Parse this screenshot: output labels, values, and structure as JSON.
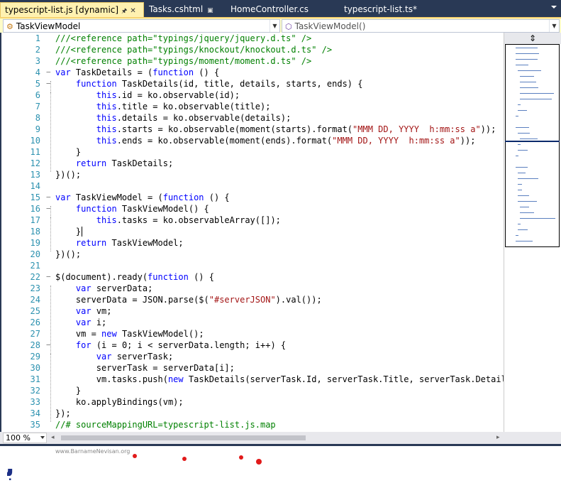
{
  "tabs": [
    {
      "label": "typescript-list.js [dynamic]",
      "active": true
    },
    {
      "label": "Tasks.cshtml",
      "active": false
    },
    {
      "label": "HomeController.cs",
      "active": false
    },
    {
      "label": "typescript-list.ts*",
      "active": false
    }
  ],
  "nav": {
    "type_combo": "TaskViewModel",
    "member_combo": "TaskViewModel()"
  },
  "lines": [
    {
      "n": "1",
      "f": "",
      "html": "<span class='c'>///&lt;reference path=\"typings/jquery/jquery.d.ts\" /&gt;</span>"
    },
    {
      "n": "2",
      "f": "",
      "html": "<span class='c'>///&lt;reference path=\"typings/knockout/knockout.d.ts\" /&gt;</span>"
    },
    {
      "n": "3",
      "f": "",
      "html": "<span class='c'>///&lt;reference path=\"typings/moment/moment.d.ts\" /&gt;</span>"
    },
    {
      "n": "4",
      "f": "−",
      "html": "<span class='k'>var</span> TaskDetails = (<span class='k'>function</span> () {"
    },
    {
      "n": "5",
      "f": "−",
      "html": "    <span class='k'>function</span> TaskDetails(id, title, details, starts, ends) {"
    },
    {
      "n": "6",
      "f": "",
      "html": "        <span class='k'>this</span>.id = ko.observable(id);"
    },
    {
      "n": "7",
      "f": "",
      "html": "        <span class='k'>this</span>.title = ko.observable(title);"
    },
    {
      "n": "8",
      "f": "",
      "html": "        <span class='k'>this</span>.details = ko.observable(details);"
    },
    {
      "n": "9",
      "f": "",
      "html": "        <span class='k'>this</span>.starts = ko.observable(moment(starts).format(<span class='s'>\"MMM DD, YYYY  h:mm:ss a\"</span>));"
    },
    {
      "n": "10",
      "f": "",
      "html": "        <span class='k'>this</span>.ends = ko.observable(moment(ends).format(<span class='s'>\"MMM DD, YYYY  h:mm:ss a\"</span>));"
    },
    {
      "n": "11",
      "f": "",
      "html": "    }"
    },
    {
      "n": "12",
      "f": "",
      "html": "    <span class='k'>return</span> TaskDetails;"
    },
    {
      "n": "13",
      "f": "",
      "html": "})();"
    },
    {
      "n": "14",
      "f": "",
      "html": ""
    },
    {
      "n": "15",
      "f": "−",
      "html": "<span class='k'>var</span> TaskViewModel = (<span class='k'>function</span> () {"
    },
    {
      "n": "16",
      "f": "−",
      "html": "    <span class='k'>function</span> TaskViewModel() {"
    },
    {
      "n": "17",
      "f": "",
      "html": "        <span class='k'>this</span>.tasks = ko.observableArray([]);"
    },
    {
      "n": "18",
      "f": "",
      "html": "    }"
    },
    {
      "n": "19",
      "f": "",
      "html": "    <span class='k'>return</span> TaskViewModel;"
    },
    {
      "n": "20",
      "f": "",
      "html": "})();"
    },
    {
      "n": "21",
      "f": "",
      "html": ""
    },
    {
      "n": "22",
      "f": "−",
      "html": "$(document).ready(<span class='k'>function</span> () {"
    },
    {
      "n": "23",
      "f": "",
      "html": "    <span class='k'>var</span> serverData;"
    },
    {
      "n": "24",
      "f": "",
      "html": "    serverData = JSON.parse($(<span class='s'>\"#serverJSON\"</span>).val());"
    },
    {
      "n": "25",
      "f": "",
      "html": "    <span class='k'>var</span> vm;"
    },
    {
      "n": "26",
      "f": "",
      "html": "    <span class='k'>var</span> i;"
    },
    {
      "n": "27",
      "f": "",
      "html": "    vm = <span class='k'>new</span> TaskViewModel();"
    },
    {
      "n": "28",
      "f": "−",
      "html": "    <span class='k'>for</span> (i = 0; i &lt; serverData.length; i++) {"
    },
    {
      "n": "29",
      "f": "",
      "html": "        <span class='k'>var</span> serverTask;"
    },
    {
      "n": "30",
      "f": "",
      "html": "        serverTask = serverData[i];"
    },
    {
      "n": "31",
      "f": "",
      "html": "        vm.tasks.push(<span class='k'>new</span> TaskDetails(serverTask.Id, serverTask.Title, serverTask.Details,"
    },
    {
      "n": "32",
      "f": "",
      "html": "    }"
    },
    {
      "n": "33",
      "f": "",
      "html": "    ko.applyBindings(vm);"
    },
    {
      "n": "34",
      "f": "",
      "html": "});"
    },
    {
      "n": "35",
      "f": "",
      "html": "<span class='c'>//# sourceMappingURL=typescript-list.js.map</span>"
    }
  ],
  "zoom": "100 %",
  "logo": {
    "url": "www.BarnameNevisan.org",
    "text": "برنامه نویسان"
  },
  "colors": {
    "keyword": "#0000ff",
    "comment": "#008000",
    "string": "#a31515",
    "line_number": "#2b91af",
    "tab_bar": "#293955",
    "nav_bar": "#fefcc8"
  }
}
